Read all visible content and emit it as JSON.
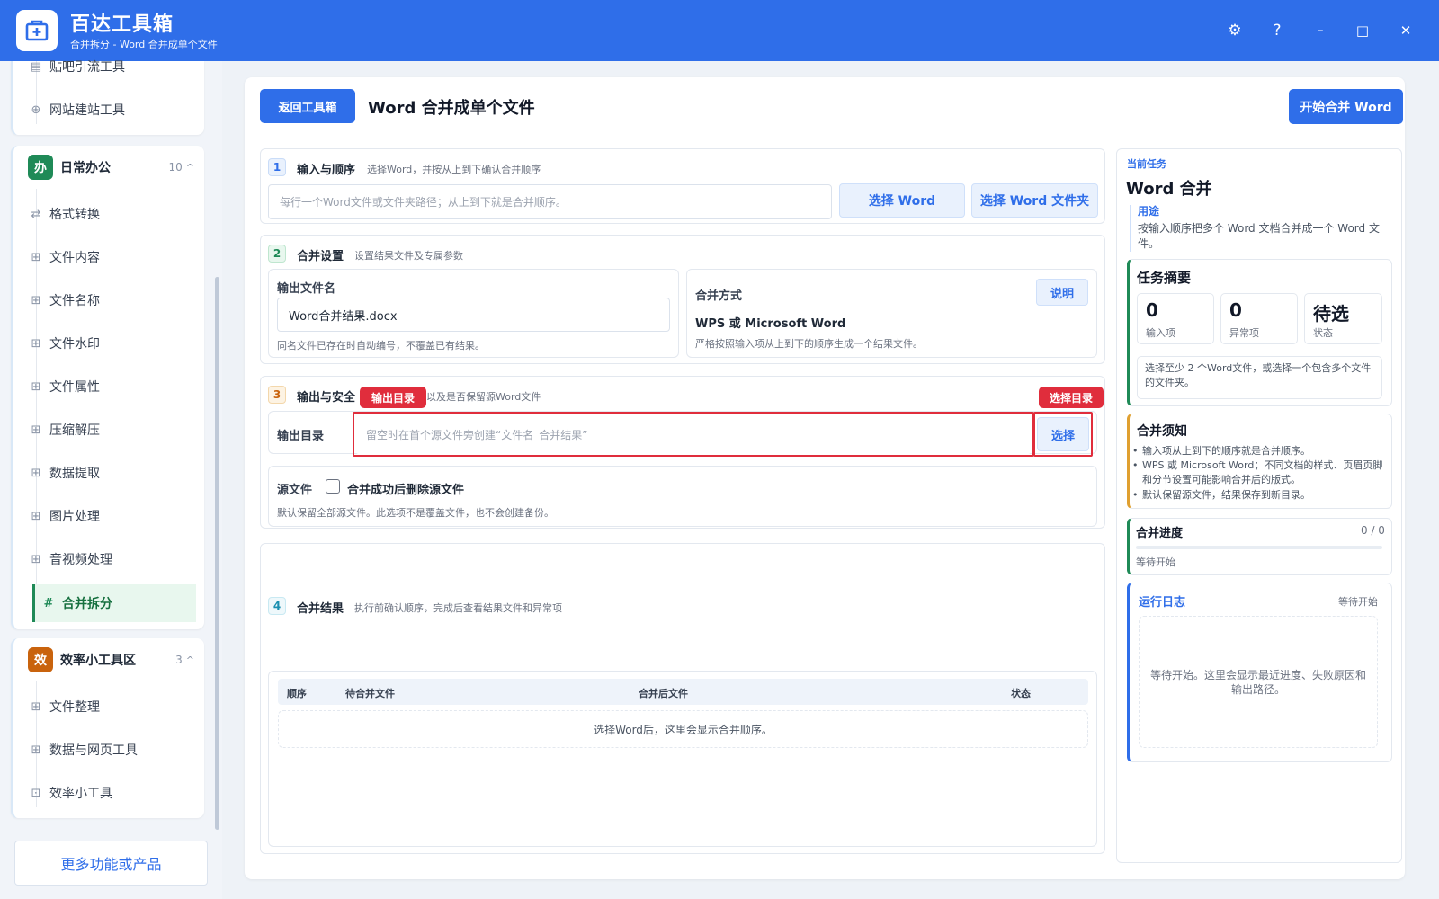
{
  "app": {
    "title": "百达工具箱",
    "subtitle": "合并拆分 - Word 合并成单个文件"
  },
  "window_controls": {
    "settings": "⚙",
    "help": "?",
    "minimize": "–",
    "maximize": "□",
    "close": "✕"
  },
  "sidebar": {
    "top_items": [
      {
        "label": "贴吧引流工具",
        "icon": "doc-icon"
      },
      {
        "label": "网站建站工具",
        "icon": "globe-icon"
      }
    ],
    "groups": [
      {
        "icon": "办",
        "name": "日常办公",
        "count": "10",
        "color": "#1f8a57",
        "items": [
          {
            "label": "格式转换",
            "icon": "swap-icon"
          },
          {
            "label": "文件内容",
            "icon": "grid-icon"
          },
          {
            "label": "文件名称",
            "icon": "grid-icon"
          },
          {
            "label": "文件水印",
            "icon": "grid-icon"
          },
          {
            "label": "文件属性",
            "icon": "grid-icon"
          },
          {
            "label": "压缩解压",
            "icon": "grid-icon"
          },
          {
            "label": "数据提取",
            "icon": "grid-icon"
          },
          {
            "label": "图片处理",
            "icon": "grid-icon"
          },
          {
            "label": "音视频处理",
            "icon": "grid-icon"
          },
          {
            "label": "合并拆分",
            "icon": "hash-icon",
            "active": true
          }
        ]
      },
      {
        "icon": "效",
        "name": "效率小工具区",
        "count": "3",
        "color": "#c9630d",
        "items": [
          {
            "label": "文件整理",
            "icon": "grid-icon"
          },
          {
            "label": "数据与网页工具",
            "icon": "grid-icon"
          },
          {
            "label": "效率小工具",
            "icon": "box-icon"
          }
        ]
      }
    ],
    "more_button": "更多功能或产品"
  },
  "header": {
    "back_button": "返回工具箱",
    "page_title": "Word 合并成单个文件",
    "start_button": "开始合并 Word"
  },
  "section1": {
    "num": "1",
    "title": "输入与顺序",
    "desc": "选择Word，并按从上到下确认合并顺序",
    "textarea_placeholder": "每行一个Word文件或文件夹路径；从上到下就是合并顺序。",
    "select_word": "选择 Word",
    "select_folder": "选择 Word 文件夹"
  },
  "section2": {
    "num": "2",
    "title": "合并设置",
    "desc": "设置结果文件及专属参数",
    "output_name_label": "输出文件名",
    "output_name_value": "Word合并结果.docx",
    "output_name_hint": "同名文件已存在时自动编号，不覆盖已有结果。",
    "merge_mode_label": "合并方式",
    "merge_mode_value": "WPS 或 Microsoft Word",
    "merge_mode_hint": "严格按照输入项从上到下的顺序生成一个结果文件。",
    "explain_button": "说明"
  },
  "section3": {
    "num": "3",
    "title": "输出与安全",
    "desc": "设置保存位置以及是否保留源Word文件",
    "output_dir_label": "输出目录",
    "output_dir_placeholder": "留空时在首个源文件旁创建“文件名_合并结果”",
    "choose_button": "选择",
    "tag_output_dir": "输出目录",
    "tag_choose_dir": "选择目录",
    "source_label": "源文件",
    "delete_checkbox_label": "合并成功后删除源文件",
    "source_hint": "默认保留全部源文件。此选项不是覆盖文件，也不会创建备份。"
  },
  "section4": {
    "num": "4",
    "title": "合并结果",
    "desc": "执行前确认顺序，完成后查看结果文件和异常项",
    "columns": [
      "顺序",
      "待合并文件",
      "合并后文件",
      "状态"
    ],
    "empty_text": "选择Word后，这里会显示合并顺序。"
  },
  "right_panel": {
    "current_task_label": "当前任务",
    "current_task_title": "Word 合并",
    "usage_label": "用途",
    "usage_text": "按输入顺序把多个 Word 文档合并成一个 Word 文件。",
    "summary_title": "任务摘要",
    "stats": [
      {
        "value": "0",
        "label": "输入项"
      },
      {
        "value": "0",
        "label": "异常项"
      },
      {
        "value": "待选",
        "label": "状态"
      }
    ],
    "summary_hint": "选择至少 2 个Word文件，或选择一个包含多个文件的文件夹。",
    "notice_title": "合并须知",
    "notices": [
      "输入项从上到下的顺序就是合并顺序。",
      "WPS 或 Microsoft Word；不同文档的样式、页眉页脚和分节设置可能影响合并后的版式。",
      "默认保留源文件，结果保存到新目录。"
    ],
    "progress_title": "合并进度",
    "progress_count": "0 / 0",
    "progress_value": 0,
    "progress_status": "等待开始",
    "log_title": "运行日志",
    "log_status": "等待开始",
    "log_empty": "等待开始。这里会显示最近进度、失败原因和输出路径。"
  },
  "colors": {
    "brand": "#2f6ee9",
    "active_green": "#1f8a57",
    "highlight_red": "#e02d3c",
    "notice_orange": "#e0a030"
  }
}
